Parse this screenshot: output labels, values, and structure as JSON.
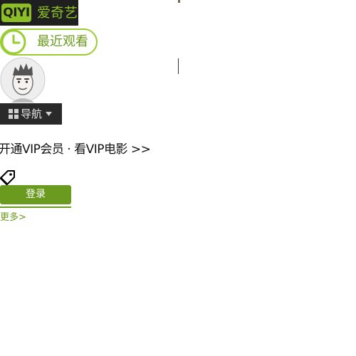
{
  "logo": {
    "mark": "QIYI",
    "name": "爱奇艺"
  },
  "recent": {
    "label": "最近观看"
  },
  "nav": {
    "label": "导航"
  },
  "vip": {
    "promo": "开通VIP会员 · 看VIP电影 >>"
  },
  "login": {
    "label": "登录"
  },
  "more": {
    "label": "更多>"
  },
  "colors": {
    "brand_green": "#8cbf26",
    "button_green": "#6a9a1e",
    "dark": "#1f1f1f"
  }
}
